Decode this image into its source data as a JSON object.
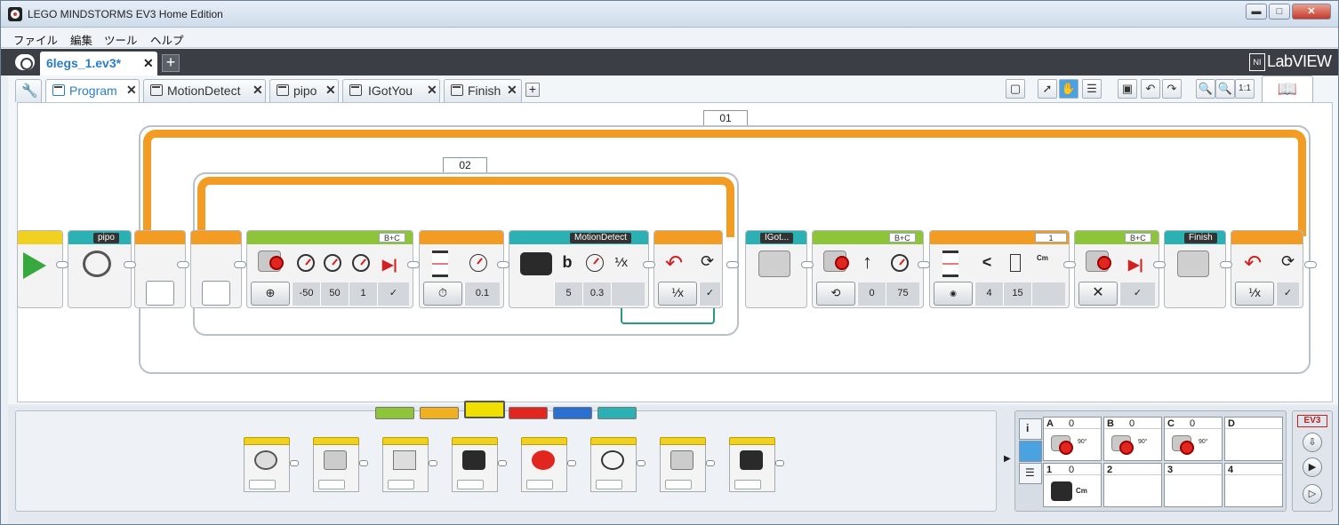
{
  "window": {
    "title": "LEGO MINDSTORMS EV3 Home Edition",
    "minimize": "▬",
    "maximize": "□",
    "close": "✕"
  },
  "menu": [
    "ファイル",
    "編集",
    "ツール",
    "ヘルプ"
  ],
  "project": {
    "tab_label": "6legs_1.ev3*",
    "close": "✕",
    "add": "+",
    "brand": "LabVIEW",
    "brand_badge": "NI"
  },
  "tabs": [
    {
      "label": "Program",
      "close": "✕"
    },
    {
      "label": "MotionDetect",
      "close": "✕"
    },
    {
      "label": "pipo",
      "close": "✕"
    },
    {
      "label": "IGotYou",
      "close": "✕"
    },
    {
      "label": "Finish",
      "close": "✕"
    }
  ],
  "toolbar": {
    "zoom_reset": "1:1",
    "add_tab": "+"
  },
  "loops": [
    {
      "label": "01"
    },
    {
      "label": "02"
    }
  ],
  "blocks": {
    "pipo": "pipo",
    "move1_ports": "B+C",
    "move1_values": [
      "-50",
      "50",
      "1"
    ],
    "wait_value": "0.1",
    "motion_tag": "MotionDetect",
    "motion_port": "b",
    "motion_values": [
      "5",
      "0.3"
    ],
    "igot": "IGot...",
    "move2_ports": "B+C",
    "move2_values": [
      "0",
      "75"
    ],
    "switch_case": "1",
    "switch_values": [
      "4",
      "15"
    ],
    "switch_op": "<",
    "switch_unit": "Cm",
    "move3_ports": "B+C",
    "finish": "Finish"
  },
  "palette": {
    "category_colors": [
      "#8ec43a",
      "#f0b020",
      "#f0e000",
      "#e0261f",
      "#2b6fd0",
      "#2bb0b3"
    ]
  },
  "hardware": {
    "ports": [
      {
        "label": "A",
        "value": "0"
      },
      {
        "label": "B",
        "value": "0"
      },
      {
        "label": "C",
        "value": "0"
      },
      {
        "label": "D",
        "value": ""
      },
      {
        "label": "1",
        "value": "0",
        "unit": "Cm"
      },
      {
        "label": "2",
        "value": ""
      },
      {
        "label": "3",
        "value": ""
      },
      {
        "label": "4",
        "value": ""
      }
    ],
    "motor_readout": "90°",
    "ev3_label": "EV3"
  }
}
